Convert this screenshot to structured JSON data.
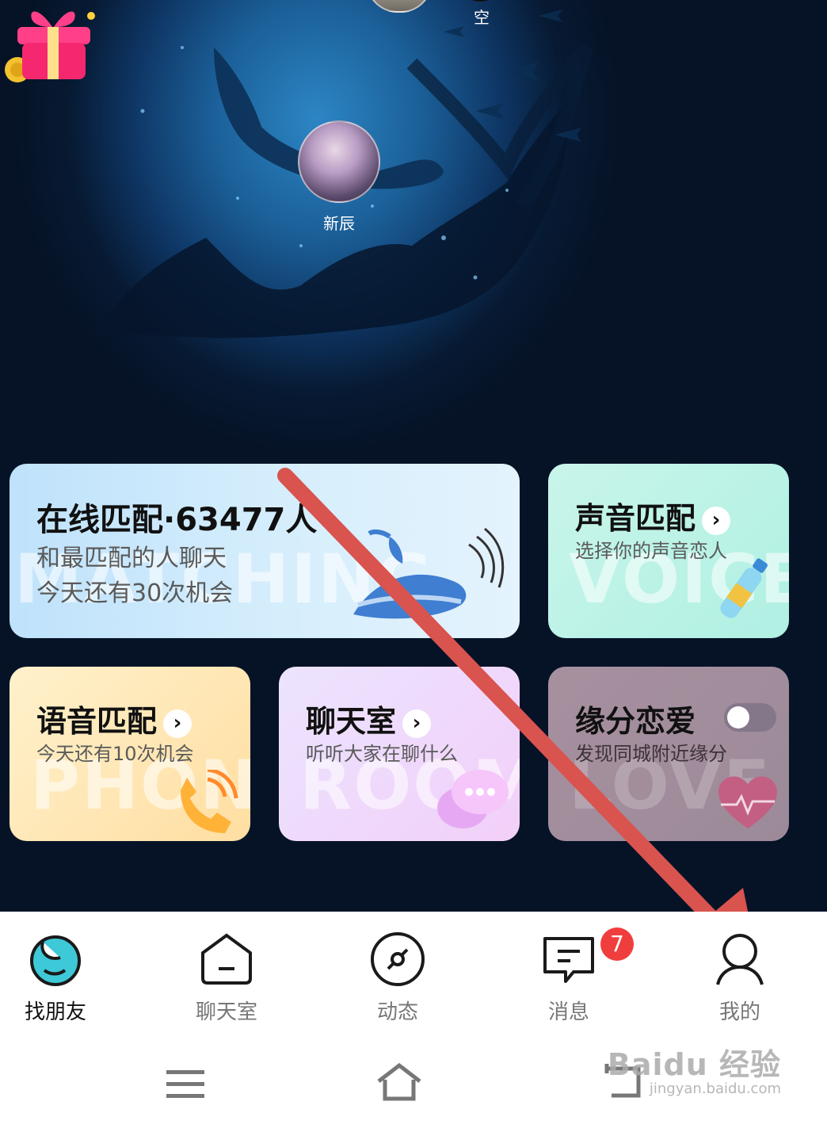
{
  "hero": {
    "top_user_name": "空",
    "user_name": "新辰"
  },
  "cards": {
    "online_match": {
      "title": "在线匹配·63477人",
      "subtitle1": "和最匹配的人聊天",
      "subtitle2": "今天还有30次机会",
      "bg_word": "MATCHING"
    },
    "voice_match": {
      "title": "声音匹配",
      "subtitle": "选择你的声音恋人",
      "bg_word": "VOICE"
    },
    "phone_match": {
      "title": "语音匹配",
      "subtitle": "今天还有10次机会",
      "bg_word": "PHONE"
    },
    "chat_room": {
      "title": "聊天室",
      "subtitle": "听听大家在聊什么",
      "bg_word": "ROOM"
    },
    "love": {
      "title": "缘分恋爱",
      "subtitle": "发现同城附近缘分",
      "bg_word": "LOVE",
      "toggle_on": false
    }
  },
  "tabbar": {
    "items": [
      {
        "label": "找朋友",
        "icon": "find-friends-icon",
        "active": true
      },
      {
        "label": "聊天室",
        "icon": "chat-room-icon",
        "active": false
      },
      {
        "label": "动态",
        "icon": "compass-icon",
        "active": false
      },
      {
        "label": "消息",
        "icon": "message-icon",
        "active": false
      },
      {
        "label": "我的",
        "icon": "profile-icon",
        "active": false
      }
    ],
    "message_badge": "7"
  },
  "watermark": {
    "brand": "Baidu 经验",
    "url": "jingyan.baidu.com"
  },
  "colors": {
    "accent_teal": "#2ec4d6",
    "arrow_red": "#d9534f",
    "badge_red": "#f03e3e"
  }
}
